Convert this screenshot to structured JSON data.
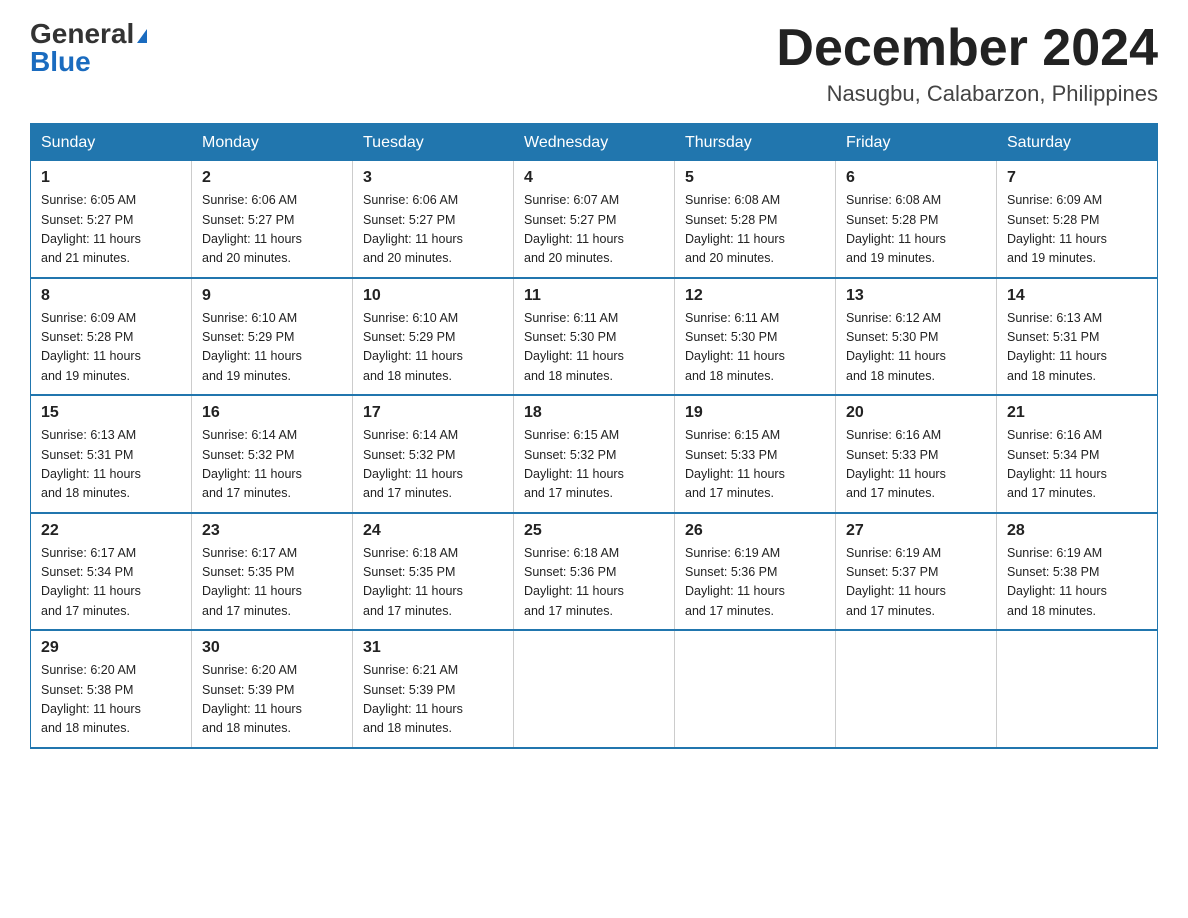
{
  "header": {
    "logo_general": "General",
    "logo_blue": "Blue",
    "month": "December 2024",
    "location": "Nasugbu, Calabarzon, Philippines"
  },
  "weekdays": [
    "Sunday",
    "Monday",
    "Tuesday",
    "Wednesday",
    "Thursday",
    "Friday",
    "Saturday"
  ],
  "weeks": [
    [
      {
        "day": "1",
        "sunrise": "6:05 AM",
        "sunset": "5:27 PM",
        "daylight": "11 hours and 21 minutes."
      },
      {
        "day": "2",
        "sunrise": "6:06 AM",
        "sunset": "5:27 PM",
        "daylight": "11 hours and 20 minutes."
      },
      {
        "day": "3",
        "sunrise": "6:06 AM",
        "sunset": "5:27 PM",
        "daylight": "11 hours and 20 minutes."
      },
      {
        "day": "4",
        "sunrise": "6:07 AM",
        "sunset": "5:27 PM",
        "daylight": "11 hours and 20 minutes."
      },
      {
        "day": "5",
        "sunrise": "6:08 AM",
        "sunset": "5:28 PM",
        "daylight": "11 hours and 20 minutes."
      },
      {
        "day": "6",
        "sunrise": "6:08 AM",
        "sunset": "5:28 PM",
        "daylight": "11 hours and 19 minutes."
      },
      {
        "day": "7",
        "sunrise": "6:09 AM",
        "sunset": "5:28 PM",
        "daylight": "11 hours and 19 minutes."
      }
    ],
    [
      {
        "day": "8",
        "sunrise": "6:09 AM",
        "sunset": "5:28 PM",
        "daylight": "11 hours and 19 minutes."
      },
      {
        "day": "9",
        "sunrise": "6:10 AM",
        "sunset": "5:29 PM",
        "daylight": "11 hours and 19 minutes."
      },
      {
        "day": "10",
        "sunrise": "6:10 AM",
        "sunset": "5:29 PM",
        "daylight": "11 hours and 18 minutes."
      },
      {
        "day": "11",
        "sunrise": "6:11 AM",
        "sunset": "5:30 PM",
        "daylight": "11 hours and 18 minutes."
      },
      {
        "day": "12",
        "sunrise": "6:11 AM",
        "sunset": "5:30 PM",
        "daylight": "11 hours and 18 minutes."
      },
      {
        "day": "13",
        "sunrise": "6:12 AM",
        "sunset": "5:30 PM",
        "daylight": "11 hours and 18 minutes."
      },
      {
        "day": "14",
        "sunrise": "6:13 AM",
        "sunset": "5:31 PM",
        "daylight": "11 hours and 18 minutes."
      }
    ],
    [
      {
        "day": "15",
        "sunrise": "6:13 AM",
        "sunset": "5:31 PM",
        "daylight": "11 hours and 18 minutes."
      },
      {
        "day": "16",
        "sunrise": "6:14 AM",
        "sunset": "5:32 PM",
        "daylight": "11 hours and 17 minutes."
      },
      {
        "day": "17",
        "sunrise": "6:14 AM",
        "sunset": "5:32 PM",
        "daylight": "11 hours and 17 minutes."
      },
      {
        "day": "18",
        "sunrise": "6:15 AM",
        "sunset": "5:32 PM",
        "daylight": "11 hours and 17 minutes."
      },
      {
        "day": "19",
        "sunrise": "6:15 AM",
        "sunset": "5:33 PM",
        "daylight": "11 hours and 17 minutes."
      },
      {
        "day": "20",
        "sunrise": "6:16 AM",
        "sunset": "5:33 PM",
        "daylight": "11 hours and 17 minutes."
      },
      {
        "day": "21",
        "sunrise": "6:16 AM",
        "sunset": "5:34 PM",
        "daylight": "11 hours and 17 minutes."
      }
    ],
    [
      {
        "day": "22",
        "sunrise": "6:17 AM",
        "sunset": "5:34 PM",
        "daylight": "11 hours and 17 minutes."
      },
      {
        "day": "23",
        "sunrise": "6:17 AM",
        "sunset": "5:35 PM",
        "daylight": "11 hours and 17 minutes."
      },
      {
        "day": "24",
        "sunrise": "6:18 AM",
        "sunset": "5:35 PM",
        "daylight": "11 hours and 17 minutes."
      },
      {
        "day": "25",
        "sunrise": "6:18 AM",
        "sunset": "5:36 PM",
        "daylight": "11 hours and 17 minutes."
      },
      {
        "day": "26",
        "sunrise": "6:19 AM",
        "sunset": "5:36 PM",
        "daylight": "11 hours and 17 minutes."
      },
      {
        "day": "27",
        "sunrise": "6:19 AM",
        "sunset": "5:37 PM",
        "daylight": "11 hours and 17 minutes."
      },
      {
        "day": "28",
        "sunrise": "6:19 AM",
        "sunset": "5:38 PM",
        "daylight": "11 hours and 18 minutes."
      }
    ],
    [
      {
        "day": "29",
        "sunrise": "6:20 AM",
        "sunset": "5:38 PM",
        "daylight": "11 hours and 18 minutes."
      },
      {
        "day": "30",
        "sunrise": "6:20 AM",
        "sunset": "5:39 PM",
        "daylight": "11 hours and 18 minutes."
      },
      {
        "day": "31",
        "sunrise": "6:21 AM",
        "sunset": "5:39 PM",
        "daylight": "11 hours and 18 minutes."
      },
      null,
      null,
      null,
      null
    ]
  ],
  "labels": {
    "sunrise": "Sunrise:",
    "sunset": "Sunset:",
    "daylight": "Daylight:"
  }
}
